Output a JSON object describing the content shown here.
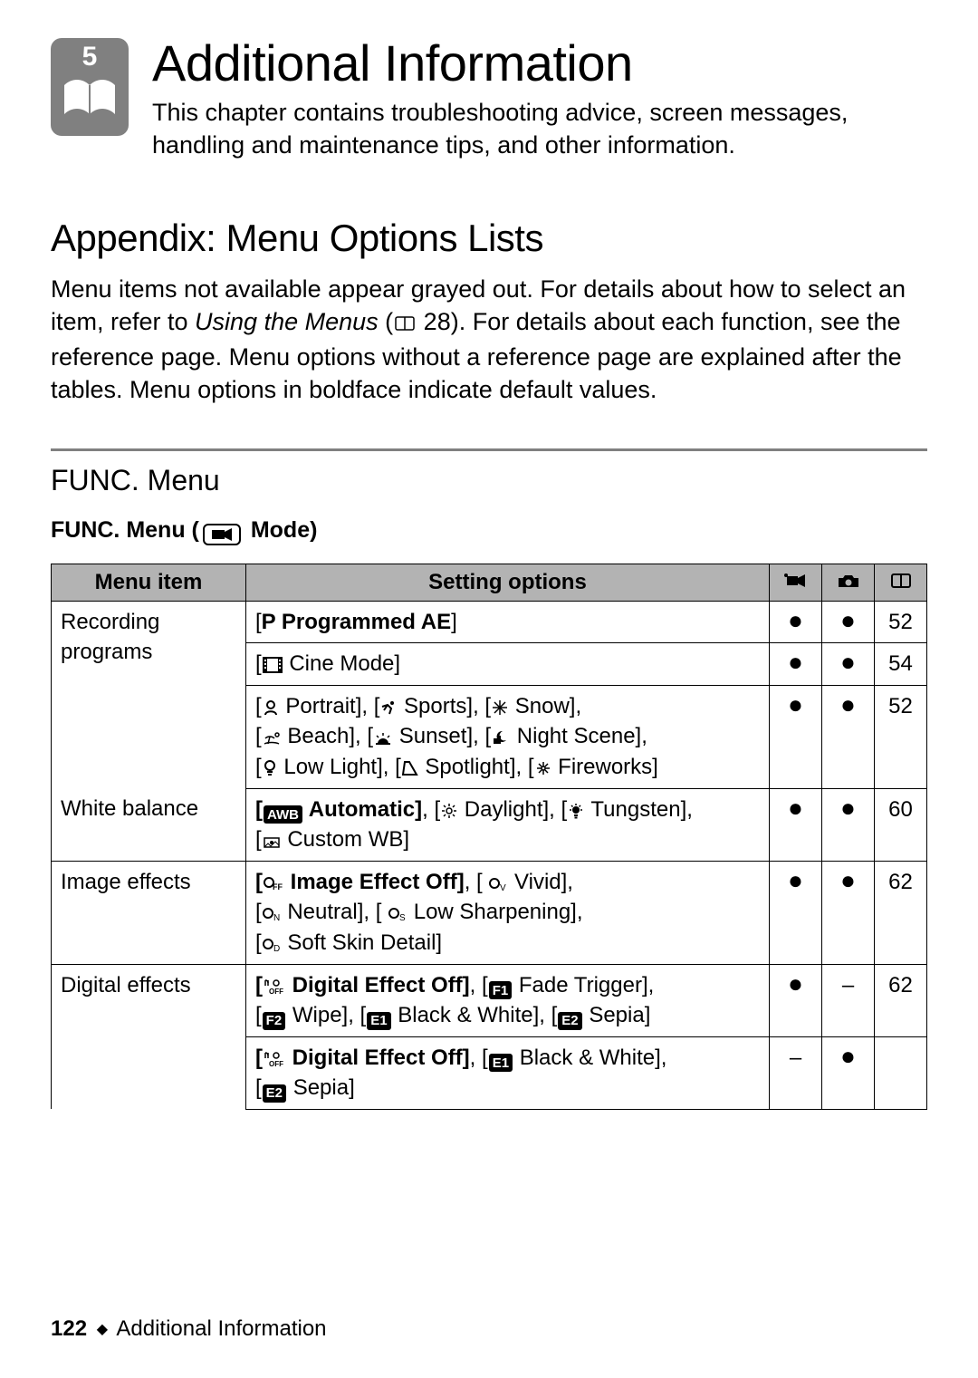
{
  "chapter": {
    "number": "5",
    "title": "Additional Information",
    "description": "This chapter contains troubleshooting advice, screen messages, handling and maintenance tips, and other information."
  },
  "appendix": {
    "title": "Appendix: Menu Options Lists",
    "desc_before_italic": "Menu items not available appear grayed out. For details about how to select an item, refer to ",
    "italic_phrase": "Using the Menus",
    "desc_paren_open": " (",
    "xref_page": "28",
    "desc_after_xref": "). For details about each function, see the reference page. Menu options without a reference page are explained after the tables. Menu options in boldface indicate default values."
  },
  "func": {
    "heading": "FUNC. Menu",
    "mode_prefix": "FUNC. Menu (",
    "mode_suffix": "  Mode)"
  },
  "table": {
    "head": {
      "item": "Menu item",
      "opts": "Setting options"
    },
    "rows": {
      "r1": {
        "item": "Recording programs",
        "opt_bold": "P Programmed AE",
        "page": "52"
      },
      "r2": {
        "opt_text": " Cine Mode]",
        "page": "54"
      },
      "r3": {
        "p1": " Portrait], [",
        "p2": " Sports], [",
        "p3": " Snow],",
        "p4": " Beach], [",
        "p5": " Sunset], [",
        "p6": " Night Scene],",
        "p7": " Low Light], [",
        "p8": " Spotlight], [",
        "p9": " Fireworks]",
        "page": "52"
      },
      "r4": {
        "item": "White balance",
        "bold": " Automatic]",
        "t1": ", [",
        "t2": " Daylight], [",
        "t3": " Tungsten],",
        "t4": " Custom WB]",
        "page": "60"
      },
      "r5": {
        "item": "Image effects",
        "bold": " Image Effect Off]",
        "t1": ", [ ",
        "t2": " Vivid],",
        "t3": " Neutral], [ ",
        "t4": " Low Sharpening],",
        "t5": " Soft Skin Detail]",
        "page": "62"
      },
      "r6": {
        "item": "Digital effects",
        "bold": " Digital Effect Off]",
        "t1": ", [",
        "t2": " Fade Trigger],",
        "t3": " Wipe], [",
        "t4": " Black & White], [",
        "t5": " Sepia]",
        "page": "62"
      },
      "r7": {
        "bold": " Digital Effect Off]",
        "t1": ", [",
        "t2": " Black & White],",
        "t3": " Sepia]"
      }
    }
  },
  "footer": {
    "page": "122",
    "section": "Additional Information"
  },
  "badges": {
    "awb": "AWB",
    "f1": "F1",
    "f2": "F2",
    "e1": "E1",
    "e2": "E2",
    "off": "OFF",
    "p": "P"
  }
}
